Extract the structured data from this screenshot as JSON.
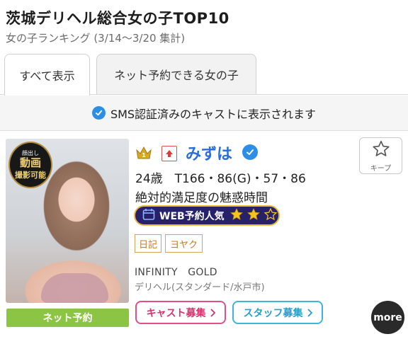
{
  "header": {
    "title": "茨城デリヘル総合女の子TOP10",
    "subtitle": "女の子ランキング (3/14〜3/20 集計)"
  },
  "tabs": [
    {
      "label": "すべて表示",
      "active": true
    },
    {
      "label": "ネット予約できる女の子",
      "active": false
    }
  ],
  "sms_notice": "SMS認証済みのキャストに表示されます",
  "cast": {
    "photo_badge": {
      "line1": "顔出し",
      "line2": "動画",
      "line3": "撮影可能"
    },
    "rank": 1,
    "rank_trend": "up",
    "name": "みずは",
    "verified": true,
    "stats": "24歳　T166・86(G)・57・86",
    "catchphrase": "絶対的満足度の魅惑時間",
    "web_badge": {
      "label": "WEB予約人気",
      "stars_filled": 2,
      "stars_total": 3
    },
    "tags": [
      "日記",
      "ヨヤク"
    ],
    "shop_name": "INFINITY　GOLD",
    "shop_type": "デリヘル(スタンダード/水戸市)",
    "net_reserve_label": "ネット予約"
  },
  "keep_button": {
    "label": "キープ",
    "icon": "star-outline-icon"
  },
  "recruit": {
    "cast_label": "キャスト募集",
    "staff_label": "スタッフ募集"
  },
  "more_label": "more",
  "colors": {
    "accent_blue": "#2d8ee6",
    "name_blue": "#2a6fd8",
    "net_green": "#8cc543",
    "cast_pink": "#e24f86",
    "staff_cyan": "#3fb3d9",
    "badge_navy": "#27216b",
    "badge_gold": "#e6b93a"
  }
}
